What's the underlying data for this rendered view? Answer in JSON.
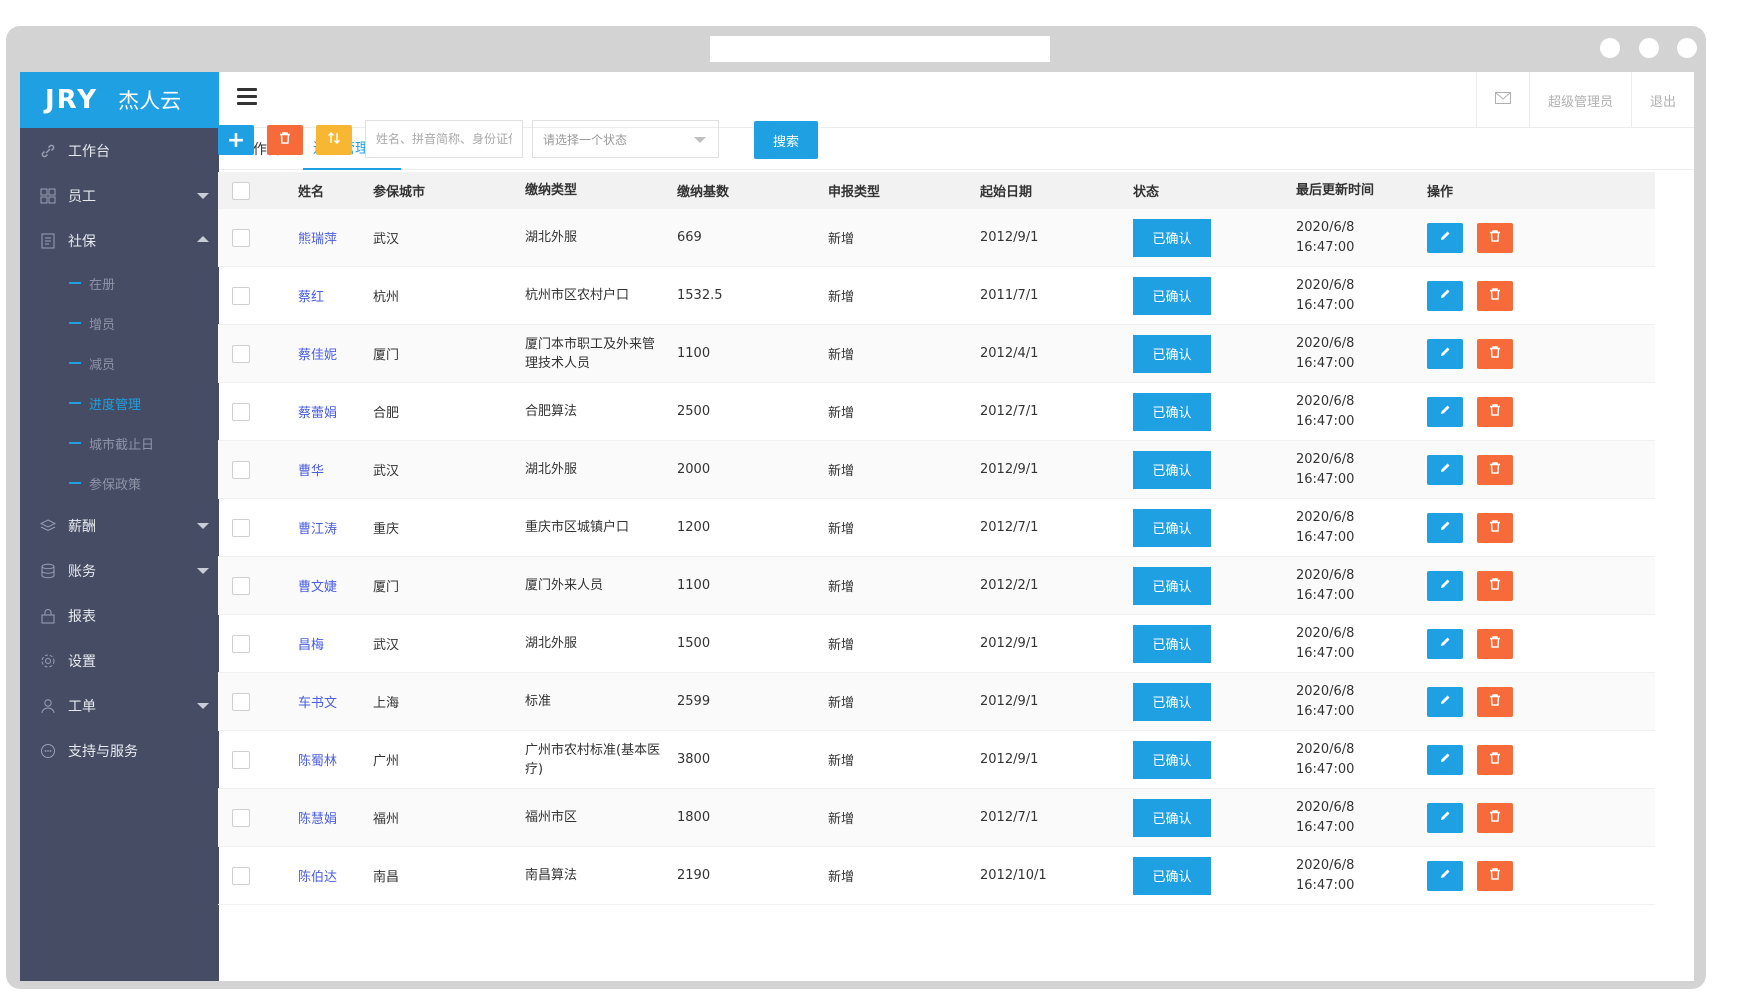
{
  "sidebar": {
    "brand": "JRY",
    "brand_cn": "杰人云",
    "items": [
      {
        "label": "工作台",
        "icon": "link-icon"
      },
      {
        "label": "员工",
        "icon": "grid-icon"
      },
      {
        "label": "社保",
        "icon": "document-icon"
      },
      {
        "label": "薪酬",
        "icon": "layers-icon"
      },
      {
        "label": "账务",
        "icon": "database-icon"
      },
      {
        "label": "报表",
        "icon": "lock-icon"
      },
      {
        "label": "设置",
        "icon": "gear-icon"
      },
      {
        "label": "工单",
        "icon": "user-icon"
      },
      {
        "label": "支持与服务",
        "icon": "chat-icon"
      }
    ],
    "sub_items": [
      "在册",
      "增员",
      "减员",
      "进度管理",
      "城市截止日",
      "参保政策"
    ]
  },
  "topbar": {
    "mail_icon": "mail-icon",
    "admin": "超级管理员",
    "logout": "退出"
  },
  "tabs": {
    "workbench": "工作台",
    "progress": "进度管理",
    "close": "×"
  },
  "toolbar": {
    "add": "+",
    "search_placeholder": "姓名、拼音简称、身份证任意",
    "status_placeholder": "请选择一个状态",
    "search_button": "搜索"
  },
  "table": {
    "headers": [
      "姓名",
      "参保城市",
      "缴纳类型",
      "缴纳基数",
      "申报类型",
      "起始日期",
      "状态",
      "最后更新时间",
      "操作"
    ],
    "rows": [
      {
        "name": "熊瑞萍",
        "city": "武汉",
        "type": "湖北外服",
        "base": "669",
        "report": "新增",
        "date": "2012/9/1",
        "status": "已确认",
        "upd1": "2020/6/8",
        "upd2": "16:47:00"
      },
      {
        "name": "蔡红",
        "city": "杭州",
        "type": "杭州市区农村户口",
        "base": "1532.5",
        "report": "新增",
        "date": "2011/7/1",
        "status": "已确认",
        "upd1": "2020/6/8",
        "upd2": "16:47:00"
      },
      {
        "name": "蔡佳妮",
        "city": "厦门",
        "type": "厦门本市职工及外来管理技术人员",
        "base": "1100",
        "report": "新增",
        "date": "2012/4/1",
        "status": "已确认",
        "upd1": "2020/6/8",
        "upd2": "16:47:00"
      },
      {
        "name": "蔡蕾娟",
        "city": "合肥",
        "type": "合肥算法",
        "base": "2500",
        "report": "新增",
        "date": "2012/7/1",
        "status": "已确认",
        "upd1": "2020/6/8",
        "upd2": "16:47:00"
      },
      {
        "name": "曹华",
        "city": "武汉",
        "type": "湖北外服",
        "base": "2000",
        "report": "新增",
        "date": "2012/9/1",
        "status": "已确认",
        "upd1": "2020/6/8",
        "upd2": "16:47:00"
      },
      {
        "name": "曹江涛",
        "city": "重庆",
        "type": "重庆市区城镇户口",
        "base": "1200",
        "report": "新增",
        "date": "2012/7/1",
        "status": "已确认",
        "upd1": "2020/6/8",
        "upd2": "16:47:00"
      },
      {
        "name": "曹文婕",
        "city": "厦门",
        "type": "厦门外来人员",
        "base": "1100",
        "report": "新增",
        "date": "2012/2/1",
        "status": "已确认",
        "upd1": "2020/6/8",
        "upd2": "16:47:00"
      },
      {
        "name": "昌梅",
        "city": "武汉",
        "type": "湖北外服",
        "base": "1500",
        "report": "新增",
        "date": "2012/9/1",
        "status": "已确认",
        "upd1": "2020/6/8",
        "upd2": "16:47:00"
      },
      {
        "name": "车书文",
        "city": "上海",
        "type": "标准",
        "base": "2599",
        "report": "新增",
        "date": "2012/9/1",
        "status": "已确认",
        "upd1": "2020/6/8",
        "upd2": "16:47:00"
      },
      {
        "name": "陈蜀林",
        "city": "广州",
        "type": "广州市农村标准(基本医疗)",
        "base": "3800",
        "report": "新增",
        "date": "2012/9/1",
        "status": "已确认",
        "upd1": "2020/6/8",
        "upd2": "16:47:00"
      },
      {
        "name": "陈慧娟",
        "city": "福州",
        "type": "福州市区",
        "base": "1800",
        "report": "新增",
        "date": "2012/7/1",
        "status": "已确认",
        "upd1": "2020/6/8",
        "upd2": "16:47:00"
      },
      {
        "name": "陈伯达",
        "city": "南昌",
        "type": "南昌算法",
        "base": "2190",
        "report": "新增",
        "date": "2012/10/1",
        "status": "已确认",
        "upd1": "2020/6/8",
        "upd2": "16:47:00"
      }
    ]
  },
  "colors": {
    "brand": "#1fa0e3",
    "sidebar": "#454c63",
    "danger": "#f76a3a",
    "warning": "#f7b733"
  }
}
